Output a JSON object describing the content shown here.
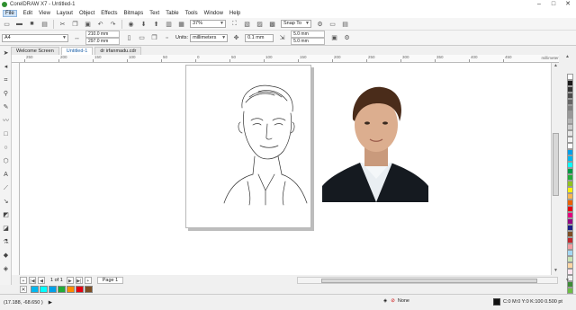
{
  "window": {
    "title": "CorelDRAW X7 - Untitled-1"
  },
  "menu": [
    "File",
    "Edit",
    "View",
    "Layout",
    "Object",
    "Effects",
    "Bitmaps",
    "Text",
    "Table",
    "Tools",
    "Window",
    "Help"
  ],
  "toolbar": {
    "zoom": "37%",
    "snap_to": "Snap To"
  },
  "property_bar": {
    "page_size": "A4",
    "width": "210.0 mm",
    "height": "297.0 mm",
    "units_label": "Units:",
    "units": "millimeters",
    "nudge": "0.1 mm",
    "dup_x": "5.0 mm",
    "dup_y": "5.0 mm"
  },
  "doc_tabs": [
    "Welcome Screen",
    "Untitled-1",
    "dr irfanmadu.cdr"
  ],
  "ruler": {
    "units": "millimeters",
    "ticks": [
      "250",
      "200",
      "150",
      "100",
      "50",
      "0",
      "50",
      "100",
      "150",
      "200",
      "250",
      "300",
      "350",
      "400",
      "450"
    ]
  },
  "page_nav": {
    "count": "1 of 1",
    "page_tab": "Page 1"
  },
  "status": {
    "coords": "(17.188, -68.650 )",
    "fill": "None",
    "outline": "C:0 M:0 Y:0 K:100  0.500 pt"
  },
  "palette_colors": [
    "#ffffff",
    "#1a1a1a",
    "#333333",
    "#4d4d4d",
    "#666666",
    "#808080",
    "#999999",
    "#b3b3b3",
    "#cccccc",
    "#e6e6e6",
    "#f2f2f2",
    "#ffffff",
    "#00a0e9",
    "#00b7ee",
    "#00ffff",
    "#009944",
    "#22ac38",
    "#8fc31f",
    "#fff100",
    "#f8b551",
    "#eb6100",
    "#e60012",
    "#e4007f",
    "#920783",
    "#1d2088",
    "#7d4e24",
    "#c1272d",
    "#f29c9f",
    "#a3d7f3",
    "#c9e4b4",
    "#fcd6a4",
    "#ffe6f0",
    "#efefef",
    "#3d8b37",
    "#6dbe45"
  ],
  "document_palette": [
    "#00b7ee",
    "#00ffff",
    "#00a0e9",
    "#22ac38",
    "#ff8c00",
    "#e60012",
    "#7d4e24"
  ]
}
